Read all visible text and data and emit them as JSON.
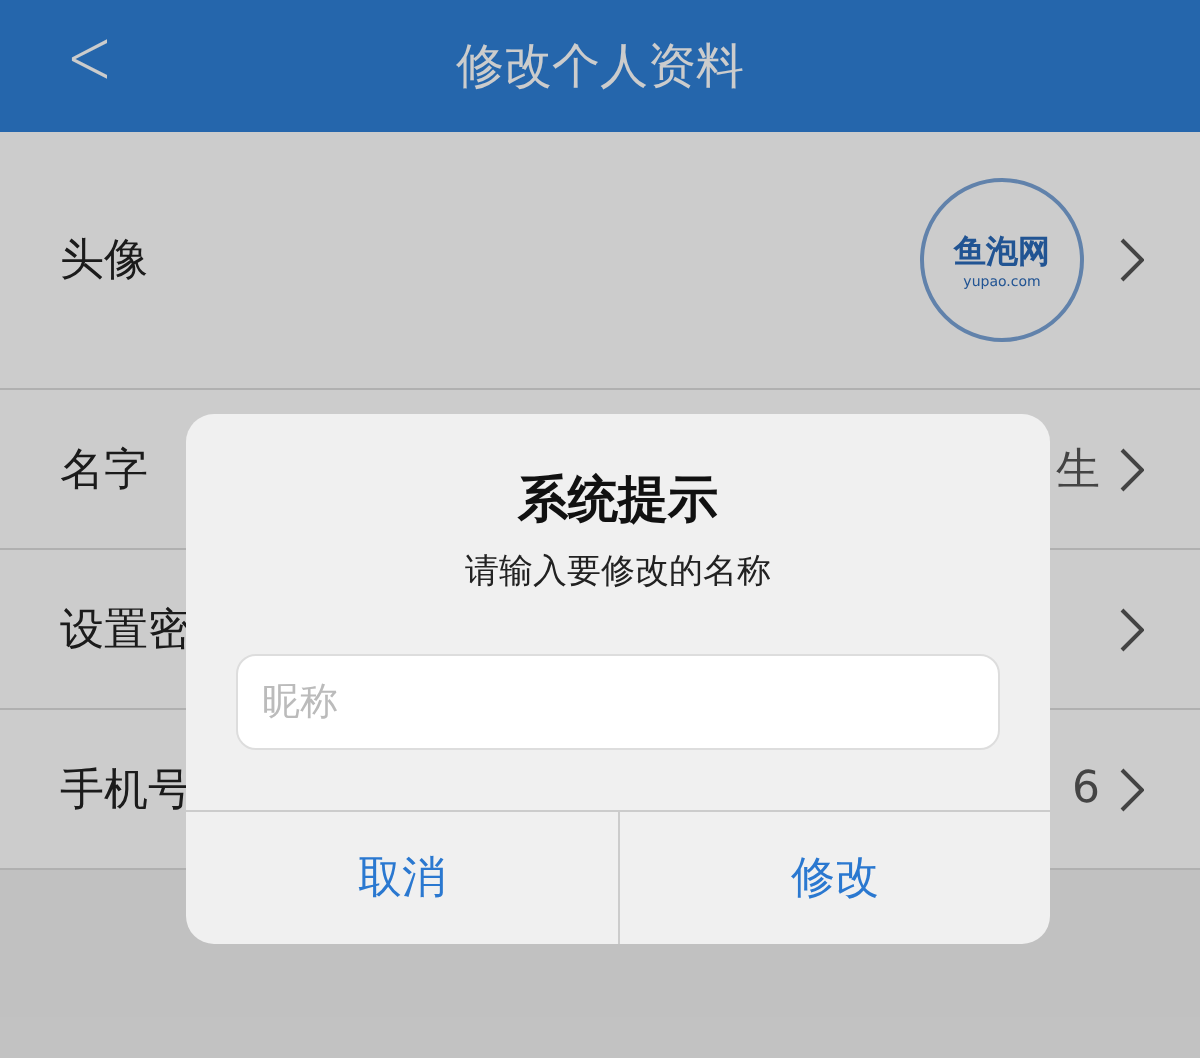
{
  "header": {
    "title": "修改个人资料",
    "back_icon": "<"
  },
  "rows": [
    {
      "kind": "avatar",
      "label": "头像",
      "logo_name": "鱼泡网",
      "logo_domain": "yupao.com"
    },
    {
      "kind": "text",
      "label": "名字",
      "value": "生"
    },
    {
      "kind": "text",
      "label": "设置密"
    },
    {
      "kind": "text",
      "label": "手机号",
      "value": "6"
    }
  ],
  "dialog": {
    "title": "系统提示",
    "message": "请输入要修改的名称",
    "input": {
      "placeholder": "昵称"
    },
    "buttons": [
      "取消",
      "修改"
    ]
  }
}
